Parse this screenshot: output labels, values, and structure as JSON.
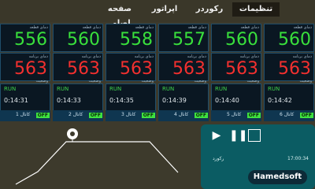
{
  "nav": {
    "items": [
      {
        "label": "صفحه اصلی",
        "active": false
      },
      {
        "label": "اپراتور",
        "active": false
      },
      {
        "label": "رکوردر",
        "active": false
      },
      {
        "label": "تنظیمات",
        "active": true
      }
    ]
  },
  "columns": [
    {
      "id": "1",
      "part_label": "دمای قطعه",
      "part_temp": "556",
      "program_label": "دمای برنامه",
      "program_temp": "563",
      "status_label": "وضعیت",
      "status": "RUN",
      "time": "0:14:31",
      "channel": "1 کانال",
      "toggle": "OFF"
    },
    {
      "id": "2",
      "part_label": "دمای قطعه",
      "part_temp": "560",
      "program_label": "دمای برنامه",
      "program_temp": "563",
      "status_label": "وضعیت",
      "status": "RUN",
      "time": "0:14:33",
      "channel": "2 کانال",
      "toggle": "OFF"
    },
    {
      "id": "3",
      "part_label": "دمای قطعه",
      "part_temp": "558",
      "program_label": "دمای برنامه",
      "program_temp": "563",
      "status_label": "وضعیت",
      "status": "RUN",
      "time": "0:14:35",
      "channel": "3 کانال",
      "toggle": "OFF"
    },
    {
      "id": "4",
      "part_label": "دمای قطعه",
      "part_temp": "557",
      "program_label": "دمای برنامه",
      "program_temp": "563",
      "status_label": "وضعیت",
      "status": "RUN",
      "time": "0:14:39",
      "channel": "4 کانال",
      "toggle": "OFF"
    },
    {
      "id": "5",
      "part_label": "دمای قطعه",
      "part_temp": "560",
      "program_label": "دمای برنامه",
      "program_temp": "563",
      "status_label": "وضعیت",
      "status": "RUN",
      "time": "0:14:40",
      "channel": "5 کانال",
      "toggle": "OFF"
    },
    {
      "id": "6",
      "part_label": "دمای قطعه",
      "part_temp": "560",
      "program_label": "دمای برنامه",
      "program_temp": "563",
      "status_label": "وضعیت",
      "status": "RUN",
      "time": "0:14:42",
      "channel": "6 کانال",
      "toggle": "OFF"
    }
  ],
  "panel": {
    "record_label": "رکورد",
    "time": "17:00:34",
    "logo": "Hamedsoft"
  },
  "colors": {
    "green": "#39e03c",
    "red": "#f3302f",
    "panel": "#0b5c63"
  }
}
